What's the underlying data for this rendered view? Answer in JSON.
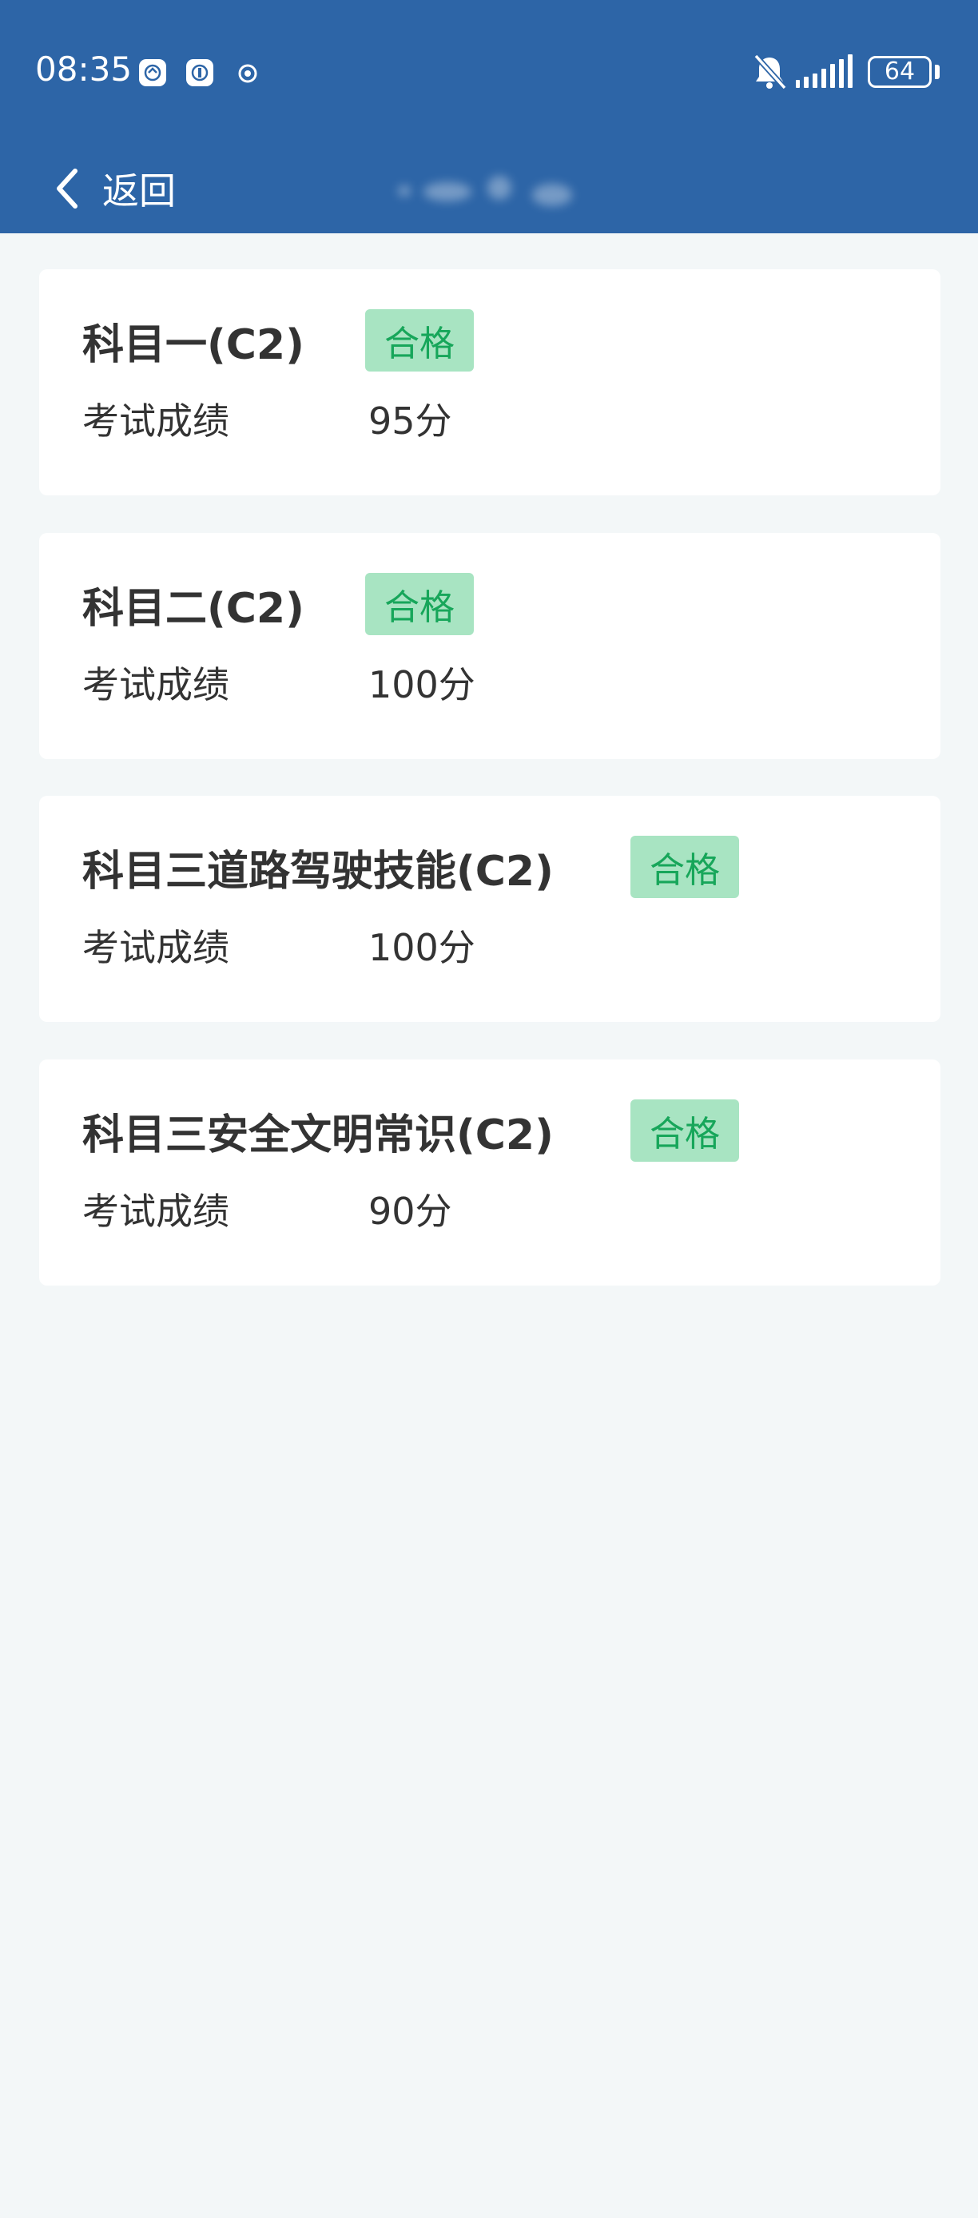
{
  "status_bar": {
    "time": "08:35",
    "battery_level": "64",
    "icons": [
      "notification-app-icon",
      "notification-app-icon",
      "notification-app-icon",
      "mute-bell-icon",
      "cellular-signal-icon",
      "battery-icon"
    ]
  },
  "nav": {
    "back_label": "返回",
    "back_icon": "chevron-left-icon"
  },
  "colors": {
    "header_bg": "#2d65a7",
    "page_bg": "#f3f7f8",
    "badge_bg": "#a8e4c2",
    "badge_text": "#17a65a"
  },
  "results": [
    {
      "subject": "科目一(C2)",
      "status": "合格",
      "score_label": "考试成绩",
      "score": "95分"
    },
    {
      "subject": "科目二(C2)",
      "status": "合格",
      "score_label": "考试成绩",
      "score": "100分"
    },
    {
      "subject": "科目三道路驾驶技能(C2)",
      "status": "合格",
      "score_label": "考试成绩",
      "score": "100分"
    },
    {
      "subject": "科目三安全文明常识(C2)",
      "status": "合格",
      "score_label": "考试成绩",
      "score": "90分"
    }
  ]
}
